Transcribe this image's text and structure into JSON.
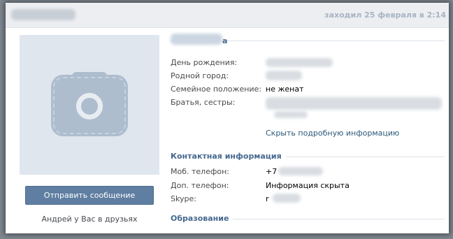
{
  "header": {
    "last_seen": "заходил 25 февраля в 2:14"
  },
  "profile": {
    "name_visible": "а",
    "photo_icon": "camera-icon"
  },
  "actions": {
    "send_message": "Отправить сообщение",
    "friends_note": "Андрей у Вас в друзьях"
  },
  "info": {
    "birthday_label": "День рождения:",
    "hometown_label": "Родной город:",
    "relationship_label": "Семейное положение:",
    "relationship_value": "не женат",
    "siblings_label": "Братья, сестры:",
    "hide_details": "Скрыть подробную информацию"
  },
  "contacts": {
    "title": "Контактная информация",
    "mobile_label": "Моб. телефон:",
    "mobile_value": "+7",
    "extra_phone_label": "Доп. телефон:",
    "extra_phone_value": "Информация скрыта",
    "skype_label": "Skype:",
    "skype_value": "r"
  },
  "education": {
    "title": "Образование"
  },
  "colors": {
    "accent": "#45688e",
    "button": "#5f7ea1",
    "link": "#2b587a"
  }
}
